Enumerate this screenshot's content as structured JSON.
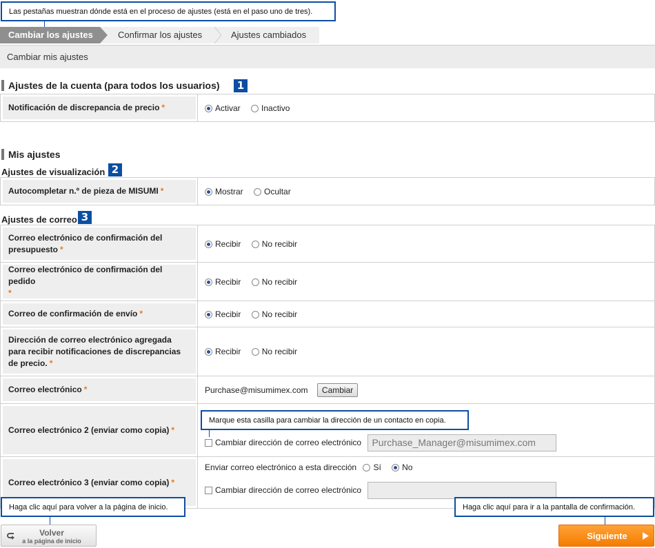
{
  "callouts": {
    "tabs": "Las pestañas muestran dónde está en el proceso de ajustes (está en el paso uno de tres).",
    "cc_checkbox": "Marque esta casilla para cambiar la dirección de un contacto en copia.",
    "back": "Haga clic aquí para volver a la página de inicio.",
    "next": "Haga clic aquí para ir a la pantalla de confirmación."
  },
  "tabs": [
    "Cambiar los ajustes",
    "Confirmar los ajustes",
    "Ajustes cambiados"
  ],
  "page_title": "Cambiar mis ajustes",
  "account_section": {
    "title": "Ajustes de la cuenta (para todos los usuarios)",
    "badge": "1",
    "price_alert": {
      "label": "Notificación de discrepancia de precio",
      "options": [
        "Activar",
        "Inactivo"
      ],
      "selected": "Activar"
    }
  },
  "my_settings": {
    "title": "Mis ajustes",
    "display": {
      "title": "Ajustes de visualización",
      "badge": "2",
      "autocomplete": {
        "label": "Autocompletar n.º de pieza de MISUMI",
        "options": [
          "Mostrar",
          "Ocultar"
        ],
        "selected": "Mostrar"
      }
    },
    "mail": {
      "title": "Ajustes de correo",
      "badge": "3",
      "quote_confirm": {
        "label": "Correo electrónico de confirmación del presupuesto",
        "options": [
          "Recibir",
          "No recibir"
        ],
        "selected": "Recibir"
      },
      "order_confirm": {
        "label": "Correo electrónico de confirmación del pedido",
        "options": [
          "Recibir",
          "No recibir"
        ],
        "selected": "Recibir"
      },
      "ship_confirm": {
        "label": "Correo de confirmación de envío",
        "options": [
          "Recibir",
          "No recibir"
        ],
        "selected": "Recibir"
      },
      "price_alert_addr": {
        "label": "Dirección de correo electrónico agregada para recibir notificaciones de discrepancias de precio.",
        "options": [
          "Recibir",
          "No recibir"
        ],
        "selected": "Recibir"
      },
      "email": {
        "label": "Correo electrónico",
        "value": "Purchase@misumimex.com",
        "button": "Cambiar"
      },
      "email2": {
        "label": "Correo electrónico 2 (enviar como copia)",
        "checkbox": "Cambiar dirección de correo electrónico",
        "value": "Purchase_Manager@misumimex.com"
      },
      "email3": {
        "label": "Correo electrónico 3 (enviar como copia)",
        "send_label": "Enviar correo electrónico a esta dirección",
        "options": [
          "Sí",
          "No"
        ],
        "selected": "No",
        "checkbox": "Cambiar dirección de correo electrónico",
        "value": ""
      }
    }
  },
  "buttons": {
    "back_main": "Volver",
    "back_sub": "a la página de inicio",
    "next": "Siguiente"
  },
  "colors": {
    "callout_border": "#0b4ea2",
    "next_button": "#f47d00",
    "required": "#e8781a"
  }
}
